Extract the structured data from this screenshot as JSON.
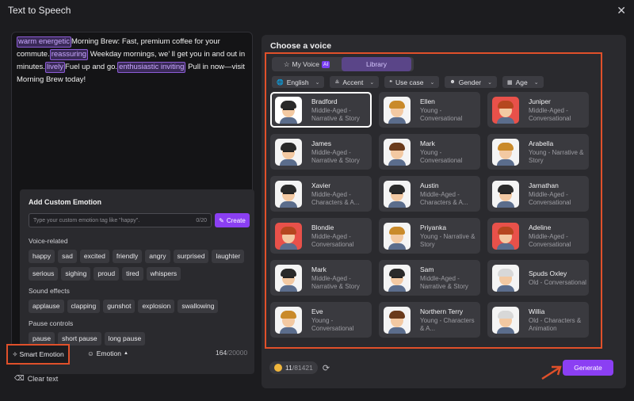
{
  "window": {
    "title": "Text to Speech",
    "close_icon": "close-icon"
  },
  "editor": {
    "segments": [
      {
        "tag": "warm energetic",
        "text": "Morning Brew: Fast, premium coffee for your commute."
      },
      {
        "tag": "reassuring",
        "text": " Weekday mornings, we’  ll get you in and out in minutes."
      },
      {
        "tag": "lively",
        "text": "Fuel up and go."
      },
      {
        "tag": "enthusiastic inviting",
        "text": " Pull in now—visit Morning Brew today!"
      }
    ]
  },
  "custom_emotion": {
    "title": "Add Custom Emotion",
    "placeholder": "Type your custom emotion tag like \"happy\".",
    "counter": "0/20",
    "create_label": "Create",
    "voice_related_label": "Voice-related",
    "voice_related": [
      "happy",
      "sad",
      "excited",
      "friendly",
      "angry",
      "surprised",
      "laughter",
      "serious",
      "sighing",
      "proud",
      "tired",
      "whispers"
    ],
    "sound_effects_label": "Sound effects",
    "sound_effects": [
      "applause",
      "clapping",
      "gunshot",
      "explosion",
      "swallowing"
    ],
    "pause_controls_label": "Pause controls",
    "pause_controls": [
      "pause",
      "short pause",
      "long pause"
    ]
  },
  "bottom": {
    "smart_emotion_label": "Smart Emotion",
    "emotion_label": "Emotion",
    "char_count": "164",
    "char_max": "/20000",
    "clear_label": "Clear text"
  },
  "voices": {
    "heading": "Choose a voice",
    "tab_my_voice": "My Voice",
    "tab_ai_badge": "AI",
    "tab_library": "Library",
    "filters": [
      "English",
      "Accent",
      "Use case",
      "Gender",
      "Age"
    ],
    "cards": [
      {
        "name": "Bradford",
        "desc": "Middle-Aged - Narrative & Story",
        "selected": true,
        "hair": "#2a2a2a",
        "bg": "#ffffff",
        "glasses": true
      },
      {
        "name": "Ellen",
        "desc": "Young - Conversational",
        "hair": "#c98a2a",
        "bg": "#f4f4f4"
      },
      {
        "name": "Juniper",
        "desc": "Middle-Aged - Conversational",
        "hair": "#b5471f",
        "bg": "#e8514a"
      },
      {
        "name": "James",
        "desc": "Middle-Aged - Narrative & Story",
        "hair": "#2a2a2a",
        "bg": "#f4f4f4",
        "glasses": true
      },
      {
        "name": "Mark",
        "desc": "Young - Conversational",
        "hair": "#6a3b1c",
        "bg": "#f4f4f4"
      },
      {
        "name": "Arabella",
        "desc": "Young - Narrative & Story",
        "hair": "#c98a2a",
        "bg": "#f4f4f4"
      },
      {
        "name": "Xavier",
        "desc": "Middle-Aged - Characters & A...",
        "hair": "#2a2a2a",
        "bg": "#f4f4f4",
        "glasses": true
      },
      {
        "name": "Austin",
        "desc": "Middle-Aged - Characters & A...",
        "hair": "#2a2a2a",
        "bg": "#f4f4f4",
        "glasses": true
      },
      {
        "name": "Jarnathan",
        "desc": "Middle-Aged - Conversational",
        "hair": "#2a2a2a",
        "bg": "#f4f4f4",
        "glasses": true
      },
      {
        "name": "Blondie",
        "desc": "Middle-Aged - Conversational",
        "hair": "#b5471f",
        "bg": "#e8514a"
      },
      {
        "name": "Priyanka",
        "desc": "Young - Narrative & Story",
        "hair": "#c98a2a",
        "bg": "#f4f4f4"
      },
      {
        "name": "Adeline",
        "desc": "Middle-Aged - Conversational",
        "hair": "#b5471f",
        "bg": "#e8514a"
      },
      {
        "name": "Mark",
        "desc": "Middle-Aged - Narrative & Story",
        "hair": "#2a2a2a",
        "bg": "#f4f4f4",
        "glasses": true
      },
      {
        "name": "Sam",
        "desc": "Middle-Aged - Narrative & Story",
        "hair": "#2a2a2a",
        "bg": "#f4f4f4",
        "glasses": true
      },
      {
        "name": "Spuds Oxley",
        "desc": "Old - Conversational",
        "hair": "#d8d8d8",
        "bg": "#f4f4f4"
      },
      {
        "name": "Eve",
        "desc": "Young - Conversational",
        "hair": "#c98a2a",
        "bg": "#f4f4f4"
      },
      {
        "name": "Northern Terry",
        "desc": "Young - Characters & A...",
        "hair": "#6a3b1c",
        "bg": "#f4f4f4"
      },
      {
        "name": "Willia",
        "desc": "Old - Characters & Animation",
        "hair": "#d8d8d8",
        "bg": "#f4f4f4"
      }
    ]
  },
  "footer": {
    "credits_used": "11",
    "credits_total": "/81421",
    "generate_label": "Generate"
  },
  "colors": {
    "accent": "#8b3ff3",
    "highlight_box": "#e0502a"
  }
}
